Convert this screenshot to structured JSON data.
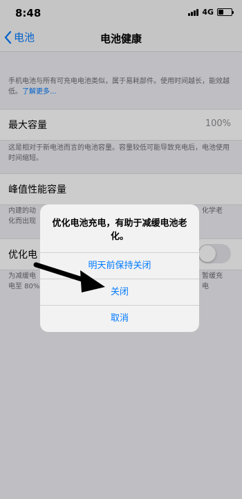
{
  "status": {
    "time": "8:48",
    "network": "4G"
  },
  "nav": {
    "back_label": "电池",
    "title": "电池健康"
  },
  "intro": {
    "text": "手机电池与所有可充电电池类似，属于易耗部件。使用时间越长，能效越低。",
    "link": "了解更多..."
  },
  "max_capacity": {
    "label": "最大容量",
    "value": "100%",
    "note": "这是相对于新电池而言的电池容量。容量较低可能导致充电后，电池使用时间缩短。"
  },
  "peak": {
    "label": "峰值性能容量",
    "note_left": "内建的动\n化而出现",
    "note_right": "化学老"
  },
  "optimized": {
    "label": "优化电",
    "note_left": "为减缓电\n电至 80%",
    "note_right": "暂缓充\n电"
  },
  "alert": {
    "message": "优化电池充电，有助于减缓电池老化。",
    "buttons": [
      "明天前保持关闭",
      "关闭",
      "取消"
    ]
  },
  "colors": {
    "accent": "#007aff",
    "arrow": "#000000"
  }
}
